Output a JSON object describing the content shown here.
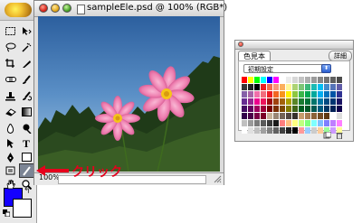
{
  "document": {
    "title": "sampleEle.psd @ 100% (RGB*)",
    "zoom": "100%"
  },
  "tools": {
    "selected": "tool-edit-in-quickmask",
    "foreground_color": "#1400ff",
    "background_color": "#ffffff",
    "items": [
      {
        "name": "rect-marquee-tool-icon"
      },
      {
        "name": "move-tool-icon"
      },
      {
        "name": "lasso-tool-icon"
      },
      {
        "name": "magic-wand-tool-icon"
      },
      {
        "name": "crop-tool-icon"
      },
      {
        "name": "slice-tool-icon"
      },
      {
        "name": "healing-brush-tool-icon"
      },
      {
        "name": "brush-tool-icon"
      },
      {
        "name": "clone-stamp-tool-icon"
      },
      {
        "name": "history-brush-tool-icon"
      },
      {
        "name": "eraser-tool-icon"
      },
      {
        "name": "gradient-tool-icon"
      },
      {
        "name": "blur-tool-icon"
      },
      {
        "name": "dodge-tool-icon"
      },
      {
        "name": "path-selection-tool-icon"
      },
      {
        "name": "type-tool-icon"
      },
      {
        "name": "pen-tool-icon"
      },
      {
        "name": "shape-tool-icon"
      },
      {
        "name": "notes-tool-icon"
      },
      {
        "name": "eyedropper-tool-icon"
      },
      {
        "name": "hand-tool-icon"
      },
      {
        "name": "zoom-tool-icon"
      }
    ]
  },
  "swatches": {
    "tab_label": "色見本",
    "menu_label": "詳細",
    "preset": "初期設定",
    "colors": [
      "#ff0000",
      "#ffff00",
      "#00ff00",
      "#00ffff",
      "#0000ff",
      "#ff00ff",
      "#ffffff",
      "#ebebeb",
      "#d7d7d7",
      "#c3c3c3",
      "#afafaf",
      "#9b9b9b",
      "#878787",
      "#737373",
      "#5f5f5f",
      "#4b4b4b",
      "#373737",
      "#232323",
      "#000000",
      "#ee1d24",
      "#f36e4f",
      "#f7977a",
      "#fbaf5d",
      "#fff799",
      "#acd373",
      "#7cc576",
      "#3cb878",
      "#1cbbb4",
      "#00bff3",
      "#448ccb",
      "#5574b9",
      "#605ca8",
      "#8560a8",
      "#a763a8",
      "#f06eaa",
      "#f26d7d",
      "#ed1c24",
      "#f26522",
      "#f7941d",
      "#fff200",
      "#8dc73f",
      "#39b54a",
      "#00a651",
      "#00a99d",
      "#00aeef",
      "#0072bc",
      "#0054a6",
      "#2e3192",
      "#662d91",
      "#92278f",
      "#ec008c",
      "#ed145b",
      "#9e0b0f",
      "#a0410d",
      "#a3620a",
      "#aba000",
      "#598527",
      "#197b30",
      "#007236",
      "#00746b",
      "#0076a3",
      "#004a80",
      "#003471",
      "#1b1464",
      "#440e62",
      "#630460",
      "#9e005d",
      "#9e0039",
      "#790000",
      "#7b2e00",
      "#7d4900",
      "#827b00",
      "#406618",
      "#005e20",
      "#005826",
      "#005952",
      "#005b7f",
      "#003663",
      "#002157",
      "#0d004c",
      "#32004b",
      "#4b0049",
      "#7b0046",
      "#7a0026",
      "#c7b299",
      "#998675",
      "#736357",
      "#534741",
      "#37302d",
      "#c69c6d",
      "#a67c52",
      "#8c6239",
      "#754c24",
      "#603913",
      "#ffffff",
      "#dddddd",
      "#c0c0c0",
      "#9a9a9a",
      "#7a7a7a",
      "#5a5a5a",
      "#3a3a3a",
      "#1a1a1a",
      "#ff7f7f",
      "#ffbf7f",
      "#ffff7f",
      "#bfff7f",
      "#7fff7f",
      "#7fffff",
      "#7fbfff",
      "#7f7fff",
      "#bf7fff",
      "#ff7fff",
      "#ffffff",
      "#e0e0e0",
      "#c0c0c0",
      "#a0a0a0",
      "#808080",
      "#606060",
      "#404040",
      "#202020",
      "#000000",
      "#ff9999",
      "#99ccff",
      "#cccccc",
      "#ffcc99",
      "#99ff99",
      "#cc99ff",
      "#ffff99"
    ]
  },
  "annotation": {
    "label": "クリック",
    "color": "#e6001c"
  }
}
